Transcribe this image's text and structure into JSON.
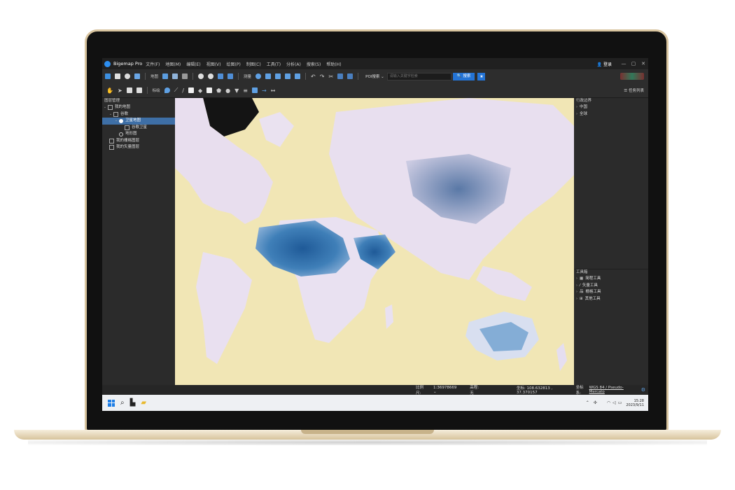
{
  "window": {
    "app_name": "Bigemap Pro",
    "menu": [
      "文件(F)",
      "地图(M)",
      "编辑(E)",
      "视图(V)",
      "绘图(P)",
      "制图(C)",
      "工具(T)",
      "分析(A)",
      "搜索(S)",
      "帮助(H)"
    ],
    "login_label": "登录",
    "minimize": "—",
    "restore": "▢",
    "close": "✕"
  },
  "toolbar": {
    "map_label": "地图",
    "measure_label": "测量",
    "annotate_label": "标绘",
    "poi_select": "POI搜索",
    "search_placeholder": "请输入关键字检索",
    "search_button": "搜索",
    "task_list": "任务列表"
  },
  "layer_panel": {
    "title": "图层管理",
    "my_map": "我的地图",
    "google": "谷歌",
    "satellite": "卫星地图",
    "google_satellite": "谷歌卫星",
    "terrain": "地形图",
    "my_raster": "我的栅格图层",
    "my_vector": "我的矢量图层"
  },
  "admin_panel": {
    "title": "行政边界",
    "items": [
      "中国",
      "全球"
    ]
  },
  "toolbox": {
    "title": "工具箱",
    "items": [
      {
        "icon": "measure-icon",
        "label": "简程工具"
      },
      {
        "icon": "vector-icon",
        "label": "矢量工具"
      },
      {
        "icon": "raster-icon",
        "label": "栅格工具"
      },
      {
        "icon": "other-icon",
        "label": "其他工具"
      }
    ]
  },
  "statusbar": {
    "scale_label": "比例尺:",
    "scale_value": "1:36978669",
    "elevation": "高程: 无",
    "coords": "坐标: 108.632813 , 37.370157",
    "crs_label": "坐标系:",
    "crs_value": "WGS 84 / Pseudo-Mercato"
  },
  "taskbar": {
    "time": "15:28",
    "date": "2023/9/11"
  },
  "colors": {
    "accent": "#2474d6",
    "selection": "#3e6fa6",
    "map_land_sand": "#f1e6b5",
    "map_water_haze": "#e9e0ef",
    "map_desert_blue": "#2f6aa5"
  }
}
